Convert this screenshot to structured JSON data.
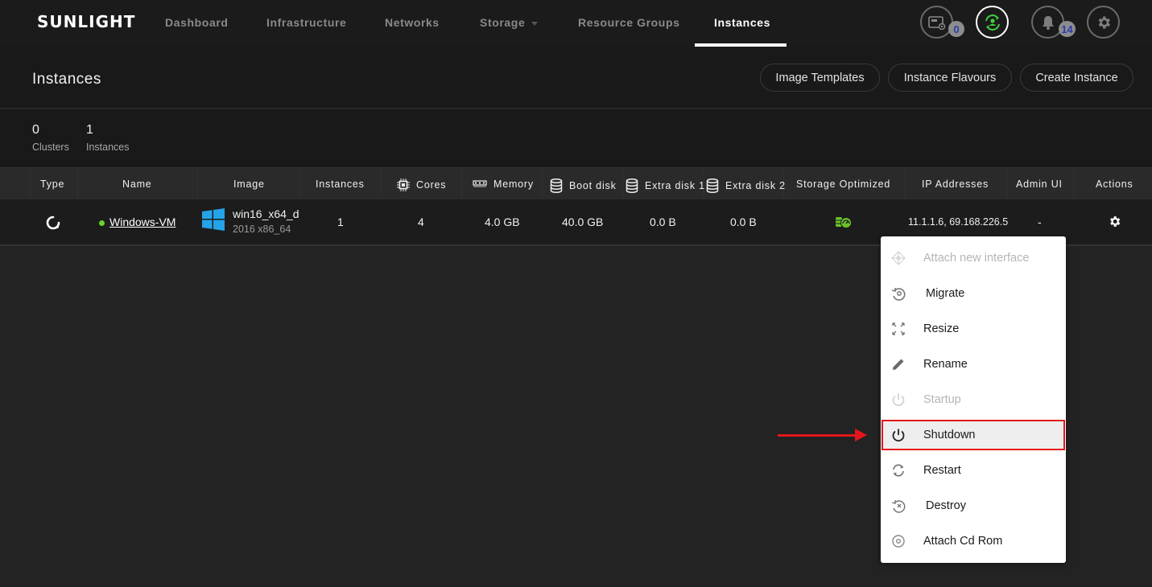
{
  "brand": {
    "logo_text": "SUNLIGHT"
  },
  "nav": {
    "items": [
      {
        "label": "Dashboard",
        "active": false
      },
      {
        "label": "Infrastructure",
        "active": false
      },
      {
        "label": "Networks",
        "active": false
      },
      {
        "label": "Storage",
        "active": false,
        "has_dropdown": true
      },
      {
        "label": "Resource Groups",
        "active": false
      },
      {
        "label": "Instances",
        "active": true
      }
    ],
    "icons": [
      {
        "name": "sim-card-icon",
        "badge": "0"
      },
      {
        "name": "user-sync-icon",
        "active": true,
        "color": "#3fd13a"
      },
      {
        "name": "bell-icon",
        "badge": "14"
      },
      {
        "name": "gear-icon"
      }
    ]
  },
  "page": {
    "title": "Instances",
    "buttons": [
      "Image Templates",
      "Instance Flavours",
      "Create Instance"
    ]
  },
  "stats": [
    {
      "value": "0",
      "label": "Clusters"
    },
    {
      "value": "1",
      "label": "Instances"
    }
  ],
  "table": {
    "columns": [
      "Type",
      "Name",
      "Image",
      "Instances",
      "Cores",
      "Memory",
      "Boot disk",
      "Extra disk 1",
      "Extra disk 2",
      "Storage Optimized",
      "IP Addresses",
      "Admin UI",
      "Actions"
    ],
    "rows": [
      {
        "type_icon": "loading-ring-icon",
        "status_color": "#6bd12a",
        "name": "Windows-VM",
        "image_name": "win16_x64_d",
        "image_sub": "2016 x86_64",
        "instances": "1",
        "cores": "4",
        "memory": "4.0 GB",
        "boot_disk": "40.0 GB",
        "extra_disk_1": "0.0 B",
        "extra_disk_2": "0.0 B",
        "storage_optimized_icon": "storage-speed-icon",
        "ip_addresses": "11.1.1.6, 69.168.226.5",
        "admin_ui": "-",
        "actions_icon": "gear-icon"
      }
    ]
  },
  "actions_menu": {
    "items": [
      {
        "label": "Attach new interface",
        "icon": "network-interface-icon",
        "disabled": true
      },
      {
        "label": "Migrate",
        "icon": "migrate-icon",
        "disabled": false
      },
      {
        "label": "Resize",
        "icon": "resize-icon",
        "disabled": false
      },
      {
        "label": "Rename",
        "icon": "pencil-icon",
        "disabled": false
      },
      {
        "label": "Startup",
        "icon": "power-icon",
        "disabled": true
      },
      {
        "label": "Shutdown",
        "icon": "power-icon",
        "disabled": false,
        "highlighted": true
      },
      {
        "label": "Restart",
        "icon": "refresh-icon",
        "disabled": false
      },
      {
        "label": "Destroy",
        "icon": "destroy-icon",
        "disabled": false
      },
      {
        "label": "Attach Cd Rom",
        "icon": "cd-rom-icon",
        "disabled": false
      }
    ]
  },
  "annotation": {
    "color": "#e4161b",
    "target": "Shutdown"
  }
}
